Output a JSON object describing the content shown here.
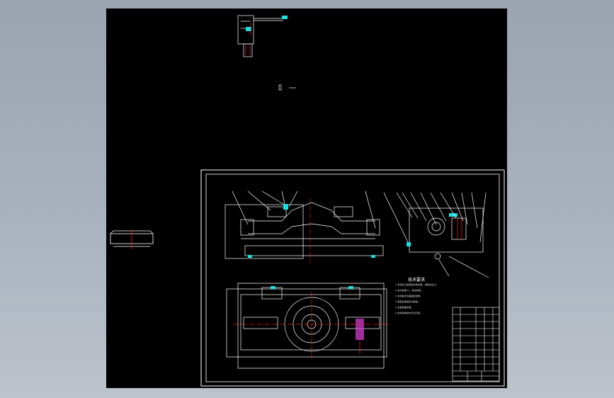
{
  "drawing": {
    "tech_requirements_title": "技术要求",
    "tech_requirements": [
      "1.零件加工前需经时效处理，消除内应力。",
      "2.未注倒角C1，锐边倒钝。",
      "3.夹具各定位面需经配磨。",
      "4.装配后检验定位精度。",
      "5.表面发黑处理。",
      "6.夹紧机构动作灵活可靠。"
    ]
  },
  "colors": {
    "background": "#9aa4b1",
    "canvas": "#000000",
    "lines": "#ffffff",
    "leaders": "#ffffff",
    "red": "#ff2020",
    "cyan": "#19e0e0",
    "magenta": "#e040e0",
    "yellow": "#e8e000",
    "green": "#20d020"
  }
}
